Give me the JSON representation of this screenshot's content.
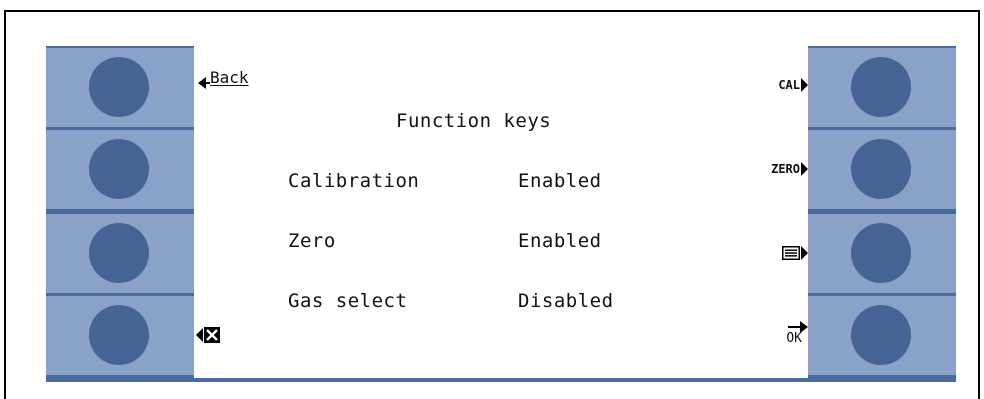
{
  "screen": {
    "back_label": "Back",
    "title": "Function keys",
    "rows": [
      {
        "name": "Calibration",
        "value": "Enabled"
      },
      {
        "name": "Zero",
        "value": "Enabled"
      },
      {
        "name": "Gas select",
        "value": "Disabled"
      }
    ],
    "softkeys": {
      "cal": "CAL",
      "zero": "ZERO",
      "ok": "OK"
    }
  },
  "icons": {
    "back": "back-arrow-icon",
    "cal": "arrow-right-icon",
    "zero": "arrow-right-icon",
    "list": "list-icon",
    "ok": "ok-arrow-icon",
    "cancel": "cancel-x-icon"
  },
  "colors": {
    "panel": "#4a6b9c",
    "key_slot": "#8aa1c8",
    "button": "#466396",
    "screen": "#ffffff"
  }
}
